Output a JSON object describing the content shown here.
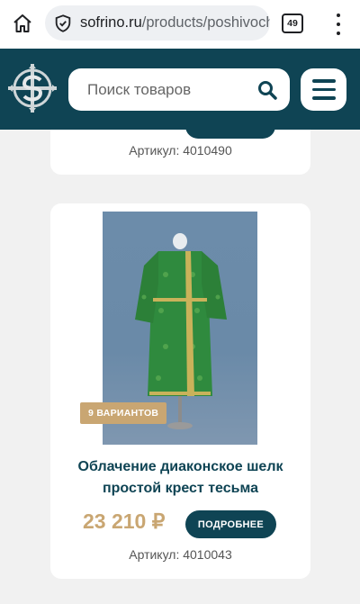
{
  "browser": {
    "url_host": "sofrino.ru",
    "url_path": "/products/poshivoch",
    "tab_count": "49"
  },
  "header": {
    "search_placeholder": "Поиск товаров",
    "brand_color": "#0f4454"
  },
  "products": [
    {
      "sku": "Артикул: 4010490"
    },
    {
      "variants_badge": "9 ВАРИАНТОВ",
      "title": "Облачение диаконское шелк простой крест тесьма",
      "price": "23 210 ₽",
      "details_label": "ПОДРОБНЕЕ",
      "sku": "Артикул: 4010043",
      "accent_color": "#c9a672"
    }
  ]
}
